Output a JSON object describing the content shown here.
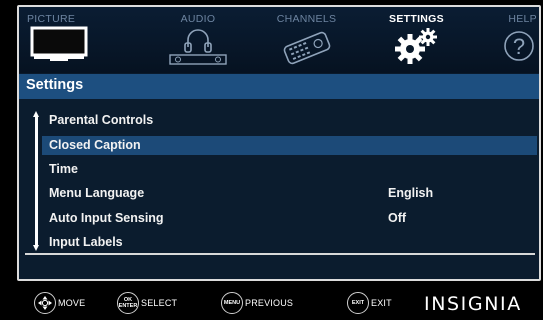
{
  "tabs": [
    {
      "label": "PICTURE",
      "icon": "tv-icon",
      "active": false
    },
    {
      "label": "AUDIO",
      "icon": "audio-icon",
      "active": false
    },
    {
      "label": "CHANNELS",
      "icon": "remote-icon",
      "active": false
    },
    {
      "label": "SETTINGS",
      "icon": "gears-icon",
      "active": true
    },
    {
      "label": "HELP",
      "icon": "help-icon",
      "active": false
    }
  ],
  "header": {
    "title": "Settings"
  },
  "menu": {
    "items": [
      {
        "label": "Parental Controls",
        "value": ""
      },
      {
        "label": "Closed Caption",
        "value": "",
        "selected": true
      },
      {
        "label": "Time",
        "value": ""
      },
      {
        "label": "Menu Language",
        "value": "English"
      },
      {
        "label": "Auto Input Sensing",
        "value": "Off"
      },
      {
        "label": "Input Labels",
        "value": ""
      }
    ]
  },
  "legend": {
    "move": {
      "label": "MOVE"
    },
    "select": {
      "label": "SELECT",
      "key": "OK ENTER"
    },
    "previous": {
      "label": "PREVIOUS",
      "key": "MENU"
    },
    "exit": {
      "label": "EXIT",
      "key": "EXIT"
    }
  },
  "brand": "INSIGNIA",
  "colors": {
    "highlight": "#1c4a78",
    "header_bar": "#1d4f80",
    "background": "#0b1c2e",
    "inactive_tab": "#6d84a0"
  }
}
